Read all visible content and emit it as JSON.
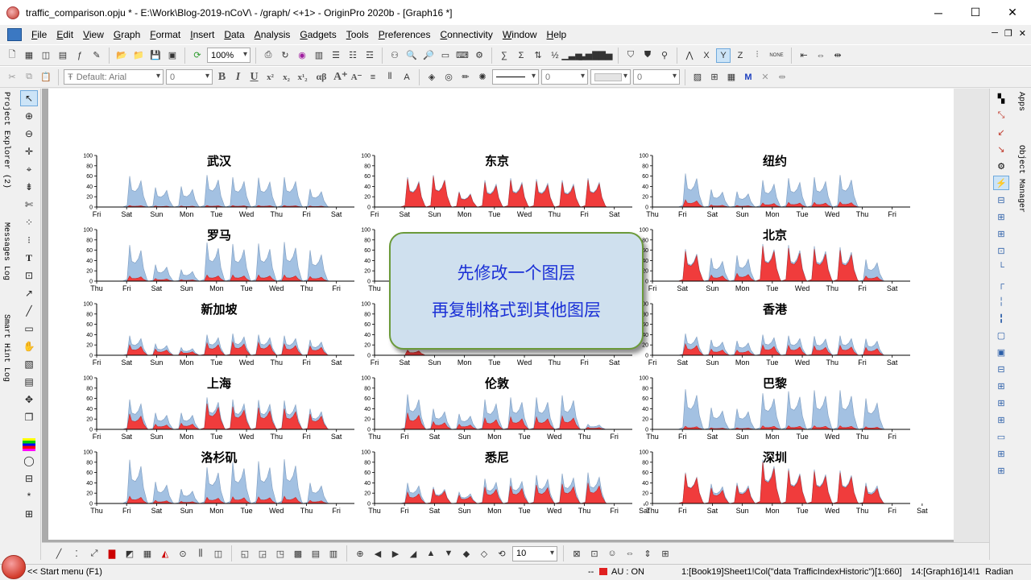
{
  "window": {
    "title": "traffic_comparison.opju * - E:\\Work\\Blog-2019-nCoV\\ - /graph/ <+1> - OriginPro 2020b - [Graph16 *]",
    "minimize": "─",
    "maximize": "☐",
    "close": "✕"
  },
  "menu": [
    "File",
    "Edit",
    "View",
    "Graph",
    "Format",
    "Insert",
    "Data",
    "Analysis",
    "Gadgets",
    "Tools",
    "Preferences",
    "Connectivity",
    "Window",
    "Help"
  ],
  "toolbar": {
    "zoom_value": "100%",
    "font_name": "Default: Arial",
    "font_size": "0",
    "line_width": "0",
    "angle_value": "0",
    "greek_label": "αβ",
    "none_label": "NONE"
  },
  "left_tabs": [
    "Project Explorer (2)",
    "Messages Log",
    "Smart Hint Log"
  ],
  "right_tabs": [
    "Apps",
    "Object Manager"
  ],
  "bottom_toolbar": {
    "size_value": "10"
  },
  "callout": {
    "line1": "先修改一个图层",
    "line2": "再复制格式到其他图层"
  },
  "status": {
    "start": "<< Start menu (F1)",
    "dashes": "--",
    "au": "AU : ON",
    "cell_info": "1:[Book19]Sheet1!Col(\"data TrafficIndexHistoric\")[1:660]",
    "layer_info": "14:[Graph16]14!1",
    "angle_unit": "Radian"
  },
  "colors": {
    "area_blue": "#a3c1e2",
    "area_red": "#f03c3c",
    "callout_fill": "#cfe0ee",
    "callout_border": "#6b9a3a",
    "callout_text": "#1a2fd6"
  },
  "chart_data": {
    "type": "area",
    "y_ticks": [
      "0",
      "20",
      "40",
      "60",
      "80",
      "100"
    ],
    "ylim": [
      0,
      100
    ],
    "panels": [
      {
        "title": "武汉",
        "x_ticks": [
          "Fri",
          "Sat",
          "Sun",
          "Mon",
          "Tue",
          "Wed",
          "Thu",
          "Fri",
          "Sat"
        ],
        "series": [
          {
            "color": "blue",
            "peaks": [
              0,
              60,
              38,
              40,
              62,
              58,
              57,
              58,
              35,
              0
            ]
          },
          {
            "color": "red",
            "peaks": [
              0,
              3,
              2,
              2,
              3,
              3,
              3,
              3,
              2,
              0
            ]
          }
        ]
      },
      {
        "title": "东京",
        "x_ticks": [
          "Fri",
          "Sat",
          "Sun",
          "Mon",
          "Tue",
          "Wed",
          "Thu",
          "Fri",
          "Sat"
        ],
        "series": [
          {
            "color": "blue",
            "peaks": [
              0,
              58,
              62,
              30,
              52,
              56,
              54,
              52,
              56,
              0
            ]
          },
          {
            "color": "red",
            "peaks": [
              0,
              55,
              60,
              28,
              48,
              52,
              50,
              48,
              53,
              0
            ]
          }
        ]
      },
      {
        "title": "纽约",
        "x_ticks": [
          "Thu",
          "Fri",
          "Sat",
          "Sun",
          "Mon",
          "Tue",
          "Wed",
          "Thu",
          "Fri"
        ],
        "series": [
          {
            "color": "blue",
            "peaks": [
              0,
              65,
              34,
              30,
              52,
              56,
              58,
              62,
              0,
              0
            ]
          },
          {
            "color": "red",
            "peaks": [
              0,
              14,
              4,
              3,
              8,
              9,
              9,
              10,
              0,
              0
            ]
          }
        ]
      },
      {
        "title": "罗马",
        "x_ticks": [
          "Thu",
          "Fri",
          "Sat",
          "Sun",
          "Mon",
          "Tue",
          "Wed",
          "Thu",
          "Fri"
        ],
        "series": [
          {
            "color": "blue",
            "peaks": [
              0,
              70,
              32,
              22,
              75,
              72,
              73,
              76,
              60,
              0
            ]
          },
          {
            "color": "red",
            "peaks": [
              0,
              10,
              5,
              3,
              12,
              12,
              12,
              12,
              9,
              0
            ]
          }
        ]
      },
      {
        "title": "",
        "x_ticks": [
          "Thu",
          "",
          "",
          "",
          "",
          "",
          "",
          "",
          ""
        ],
        "series": [
          {
            "color": "blue",
            "peaks": [
              0,
              20,
              0,
              0,
              0,
              0,
              0,
              0,
              0,
              0
            ]
          },
          {
            "color": "red",
            "peaks": [
              0,
              10,
              0,
              0,
              0,
              0,
              0,
              0,
              0,
              0
            ]
          }
        ]
      },
      {
        "title": "北京",
        "x_ticks": [
          "Fri",
          "Sat",
          "Sun",
          "Mon",
          "Tue",
          "Wed",
          "Thu",
          "Fri",
          "Sat"
        ],
        "series": [
          {
            "color": "blue",
            "peaks": [
              0,
              62,
              45,
              50,
              72,
              70,
              68,
              66,
              42,
              0
            ]
          },
          {
            "color": "red",
            "peaks": [
              0,
              58,
              12,
              15,
              68,
              64,
              62,
              60,
              10,
              0
            ]
          }
        ]
      },
      {
        "title": "新加坡",
        "x_ticks": [
          "Fri",
          "Sat",
          "Sun",
          "Mon",
          "Tue",
          "Wed",
          "Thu",
          "Fri",
          "Sat"
        ],
        "series": [
          {
            "color": "blue",
            "peaks": [
              0,
              38,
              22,
              15,
              40,
              42,
              40,
              38,
              30,
              0
            ]
          },
          {
            "color": "red",
            "peaks": [
              0,
              20,
              12,
              8,
              24,
              26,
              25,
              22,
              18,
              0
            ]
          }
        ]
      },
      {
        "title": "",
        "x_ticks": [
          "Fri",
          "Sat",
          "Sun",
          "Mon",
          "Tue",
          "Wed",
          "Thu",
          "Fri",
          "Sat"
        ],
        "series": [
          {
            "color": "blue",
            "peaks": [
              0,
              0,
              0,
              0,
              0,
              0,
              0,
              0,
              0,
              0
            ]
          },
          {
            "color": "red",
            "peaks": [
              0,
              10,
              0,
              0,
              0,
              0,
              0,
              0,
              0,
              0
            ]
          }
        ]
      },
      {
        "title": "香港",
        "x_ticks": [
          "Fri",
          "Sat",
          "Sun",
          "Mon",
          "Tue",
          "Wed",
          "Thu",
          "Fri",
          "Sat"
        ],
        "series": [
          {
            "color": "blue",
            "peaks": [
              0,
              42,
              30,
              28,
              40,
              38,
              37,
              38,
              32,
              0
            ]
          },
          {
            "color": "red",
            "peaks": [
              0,
              22,
              12,
              10,
              20,
              19,
              18,
              19,
              15,
              0
            ]
          }
        ]
      },
      {
        "title": "上海",
        "x_ticks": [
          "Fri",
          "Sat",
          "Sun",
          "Mon",
          "Tue",
          "Wed",
          "Thu",
          "Fri",
          "Sat"
        ],
        "series": [
          {
            "color": "blue",
            "peaks": [
              0,
              58,
              32,
              32,
              62,
              58,
              57,
              56,
              40,
              0
            ]
          },
          {
            "color": "red",
            "peaks": [
              0,
              30,
              10,
              12,
              50,
              44,
              42,
              40,
              30,
              0
            ]
          }
        ]
      },
      {
        "title": "伦敦",
        "x_ticks": [
          "Thu",
          "Fri",
          "Sat",
          "Sun",
          "Mon",
          "Tue",
          "Wed",
          "Thu",
          "Fri"
        ],
        "series": [
          {
            "color": "blue",
            "peaks": [
              0,
              68,
              40,
              30,
              58,
              62,
              62,
              66,
              10,
              0
            ]
          },
          {
            "color": "red",
            "peaks": [
              0,
              32,
              15,
              10,
              22,
              24,
              24,
              26,
              4,
              0
            ]
          }
        ]
      },
      {
        "title": "巴黎",
        "x_ticks": [
          "Thu",
          "Fri",
          "Sat",
          "Sun",
          "Mon",
          "Tue",
          "Wed",
          "Thu",
          "Fri"
        ],
        "series": [
          {
            "color": "blue",
            "peaks": [
              0,
              78,
              42,
              40,
              70,
              74,
              76,
              76,
              60,
              0
            ]
          },
          {
            "color": "red",
            "peaks": [
              0,
              6,
              3,
              3,
              7,
              7,
              7,
              7,
              5,
              0
            ]
          }
        ]
      },
      {
        "title": "洛杉矶",
        "x_ticks": [
          "Thu",
          "Fri",
          "Sat",
          "Sun",
          "Mon",
          "Tue",
          "Wed",
          "Thu",
          "Fri"
        ],
        "series": [
          {
            "color": "blue",
            "peaks": [
              0,
              85,
              42,
              28,
              70,
              80,
              82,
              86,
              40,
              0
            ]
          },
          {
            "color": "red",
            "peaks": [
              0,
              14,
              6,
              4,
              12,
              13,
              13,
              14,
              6,
              0
            ]
          }
        ]
      },
      {
        "title": "悉尼",
        "x_ticks": [
          "Thu",
          "Fri",
          "Sat",
          "Sun",
          "Mon",
          "Tue",
          "Wed",
          "Thu",
          "Fri",
          "Sat"
        ],
        "series": [
          {
            "color": "blue",
            "peaks": [
              0,
              40,
              32,
              22,
              48,
              50,
              55,
              58,
              60,
              0
            ]
          },
          {
            "color": "red",
            "peaks": [
              0,
              22,
              28,
              16,
              32,
              34,
              36,
              38,
              40,
              0
            ]
          }
        ]
      },
      {
        "title": "深圳",
        "x_ticks": [
          "Thu",
          "Fri",
          "Sat",
          "Sun",
          "Mon",
          "Tue",
          "Wed",
          "Thu",
          "Fri",
          "Sat"
        ],
        "series": [
          {
            "color": "blue",
            "peaks": [
              0,
              60,
              38,
              40,
              85,
              68,
              66,
              64,
              40,
              0
            ]
          },
          {
            "color": "red",
            "peaks": [
              0,
              58,
              30,
              35,
              80,
              64,
              62,
              60,
              34,
              0
            ]
          }
        ]
      }
    ]
  }
}
